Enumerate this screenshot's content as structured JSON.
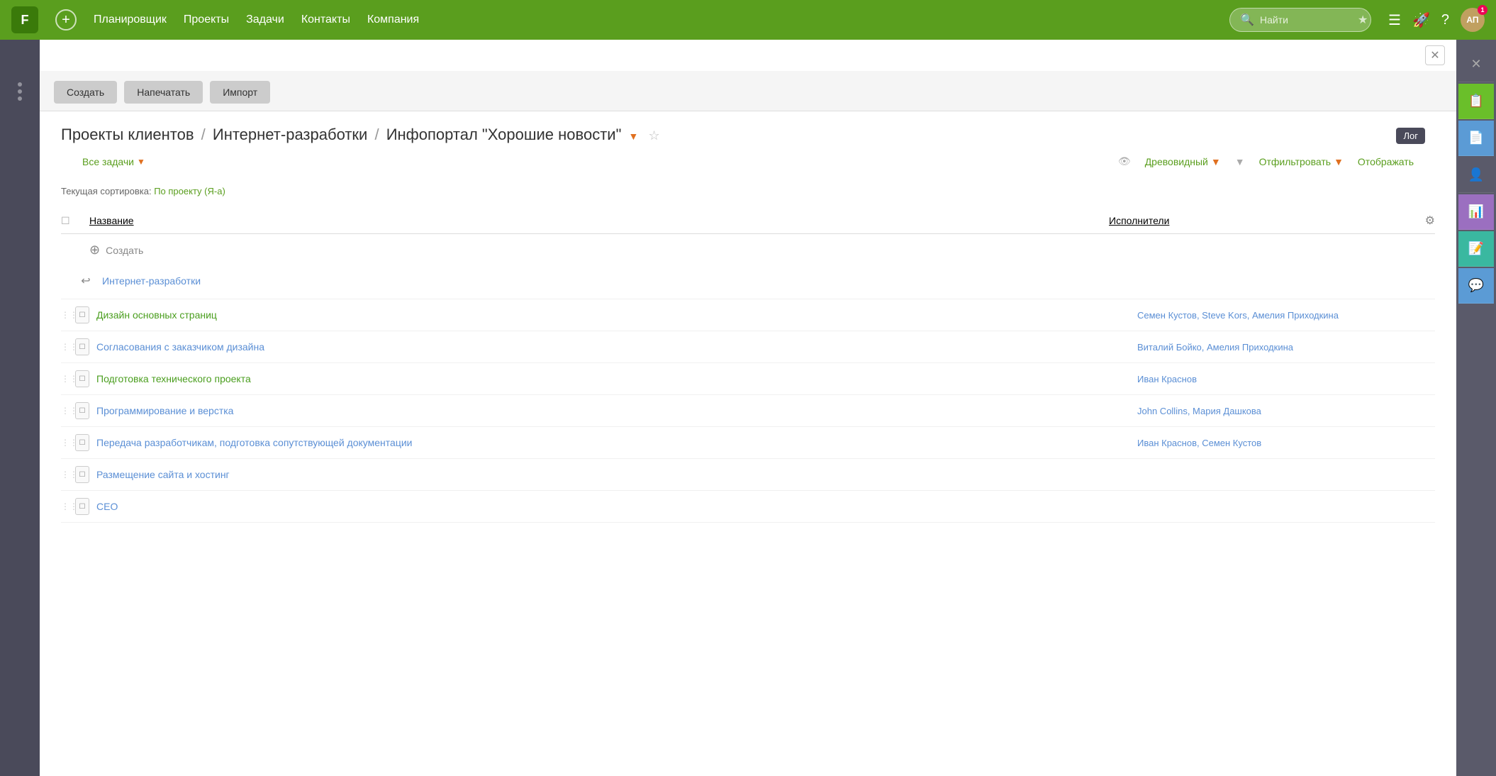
{
  "nav": {
    "logo": "F",
    "add_label": "+",
    "items": [
      "Планировщик",
      "Проекты",
      "Задачи",
      "Контакты",
      "Компания"
    ],
    "search_placeholder": "Найти",
    "icons": [
      "≡",
      "🔔",
      "?"
    ],
    "avatar_initials": "АП",
    "avatar_badge": "1"
  },
  "toolbar": {
    "create": "Создать",
    "print": "Напечатать",
    "import": "Импорт"
  },
  "breadcrumb": {
    "parts": [
      "Проекты клиентов",
      "Интернет-разработки",
      "Инфопортал \"Хорошие новости\""
    ],
    "log_badge": "Лог"
  },
  "filter_bar": {
    "all_tasks": "Все задачи",
    "view_label": "Древовидный",
    "filter_label": "Отфильтровать",
    "display_label": "Отображать"
  },
  "sort_info": {
    "label": "Текущая сортировка:",
    "value": "По проекту (Я-а)"
  },
  "table": {
    "col_name": "Название",
    "col_assignee": "Исполнители",
    "create_label": "Создать",
    "parent_link": "Интернет-разработки",
    "rows": [
      {
        "name": "Дизайн основных страниц",
        "style": "green",
        "assignees": "Семен Кустов, Steve Kors, Амелия Приходкина"
      },
      {
        "name": "Согласования с заказчиком дизайна",
        "style": "blue",
        "assignees": "Виталий Бойко, Амелия Приходкина"
      },
      {
        "name": "Подготовка технического проекта",
        "style": "green",
        "assignees": "Иван Краснов"
      },
      {
        "name": "Программирование и верстка",
        "style": "blue",
        "assignees": "John Collins, Мария Дашкова"
      },
      {
        "name": "Передача разработчикам, подготовка сопутствующей документации",
        "style": "blue",
        "assignees": "Иван Краснов, Семен Кустов"
      },
      {
        "name": "Размещение сайта и хостинг",
        "style": "blue",
        "assignees": ""
      },
      {
        "name": "CEO",
        "style": "blue",
        "assignees": ""
      }
    ]
  },
  "right_sidebar": {
    "buttons": [
      {
        "icon": "✏",
        "type": "close"
      },
      {
        "icon": "📋",
        "type": "active-green"
      },
      {
        "icon": "📄",
        "type": "active-blue"
      },
      {
        "icon": "👤",
        "type": "default"
      },
      {
        "icon": "📊",
        "type": "active-purple"
      },
      {
        "icon": "📝",
        "type": "active-teal"
      },
      {
        "icon": "💬",
        "type": "active-chat"
      }
    ]
  },
  "log_tooltip": "Лог"
}
